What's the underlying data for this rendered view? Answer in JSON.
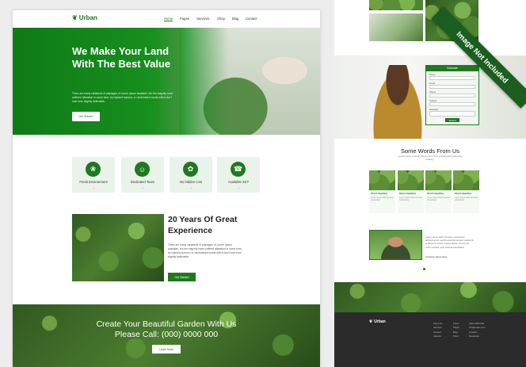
{
  "brand": {
    "name": "Urban",
    "accent": "#1e7a1e"
  },
  "nav": {
    "items": [
      "Home",
      "Pages",
      "Services",
      "Shop",
      "Blog",
      "Contact"
    ],
    "active": "Home"
  },
  "hero": {
    "title": "We Make Your Land With The Best Value",
    "text": "There are many variations of passages of Lorem Ipsum available, but the majority have suffered alteration in some form, by injected humour, or randomised words which don't look even slightly believable.",
    "button": "Get Started"
  },
  "features": [
    {
      "label": "Fresh Environment",
      "icon": "leaf-icon"
    },
    {
      "label": "Dedicated Team",
      "icon": "team-icon"
    },
    {
      "label": "No hidden cost",
      "icon": "plant-icon"
    },
    {
      "label": "Available 24/7",
      "icon": "headset-icon"
    }
  ],
  "arrow": "→",
  "experience": {
    "title": "20 Years Of Great Experience",
    "text": "There are many variations of passages of Lorem Ipsum available, but the majority have suffered alteration in some form, by injected humour, or randomised words which don't look even slightly believable.",
    "button": "Get Started"
  },
  "cta": {
    "line1": "Create Your Beautiful Garden With Us",
    "line2": "Please Call: (000) 0000 000",
    "button": "Learn More"
  },
  "contact_form": {
    "title": "Estimate",
    "fields": [
      "Name",
      "Email",
      "Phone",
      "Subject",
      "Message"
    ],
    "button": "Submit"
  },
  "testimonials": {
    "title": "Some Words From Us",
    "subtitle": "Lorem ipsum is simply dummy text of the printing and typesetting industry.",
    "cards": [
      {
        "title": "Short Headline",
        "text": "Lorem ipsum dolor sit amet consectetur"
      },
      {
        "title": "Short Headline",
        "text": "Lorem ipsum dolor sit amet consectetur"
      },
      {
        "title": "Short Headline",
        "text": "Lorem ipsum dolor sit amet consectetur"
      },
      {
        "title": "Short Headline",
        "text": "Lorem ipsum dolor sit amet consectetur"
      }
    ],
    "quote": "Lorem ipsum dolor sit amet, consectetur adipiscing elit, sed do eiusmod tempor incididunt ut labore et dolore magna aliqua. Ut enim ad minim veniam, quis nostrud exercitation.",
    "author": "Customer Name Here"
  },
  "footer": {
    "logo": "Urban",
    "col1": [
      "About Us",
      "Services",
      "Contact",
      "Careers"
    ],
    "col2": [
      "Home",
      "Pages",
      "Blog",
      "Shop"
    ],
    "col3": [
      "(000) 0000 000",
      "info@urban.com",
      "Location",
      "Newsletter"
    ]
  },
  "watermark": "Image Not Included"
}
